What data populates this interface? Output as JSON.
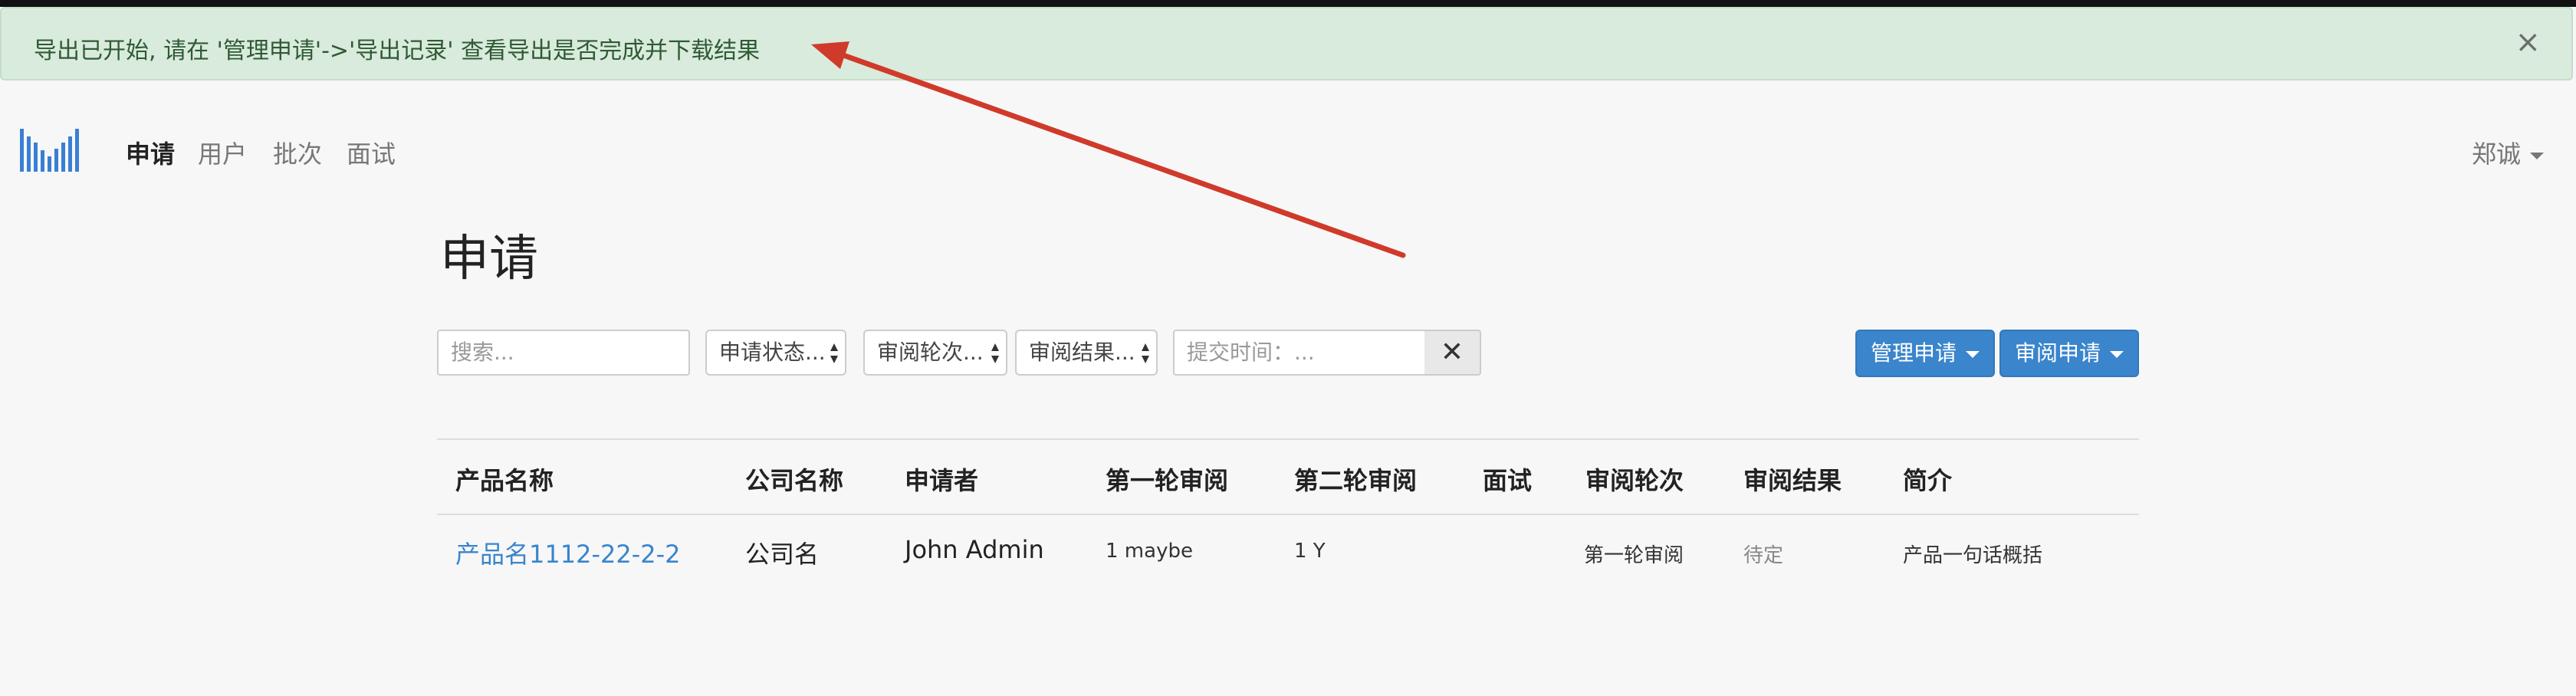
{
  "alert": {
    "message": "导出已开始, 请在 '管理申请'->'导出记录' 查看导出是否完成并下载结果",
    "close": "×"
  },
  "nav": {
    "items": [
      "申请",
      "用户",
      "批次",
      "面试"
    ],
    "user": "郑诚"
  },
  "page": {
    "title": "申请"
  },
  "filters": {
    "search_placeholder": "搜索...",
    "status": "申请状态...",
    "round": "审阅轮次...",
    "result": "审阅结果...",
    "submit_time_placeholder": "提交时间：...",
    "clear": "✕"
  },
  "actions": {
    "manage": "管理申请",
    "review": "审阅申请"
  },
  "table": {
    "headers": [
      "产品名称",
      "公司名称",
      "申请者",
      "第一轮审阅",
      "第二轮审阅",
      "面试",
      "审阅轮次",
      "审阅结果",
      "简介"
    ],
    "rows": [
      {
        "product": "产品名1112-22-2-2",
        "company": "公司名",
        "applicant": "John Admin",
        "round1": "1 maybe",
        "round2": "1 Y",
        "interview": "",
        "round": "第一轮审阅",
        "result": "待定",
        "intro": "产品一句话概括"
      }
    ]
  },
  "colors": {
    "alert_bg": "#d9ebdc",
    "primary": "#3a85cc",
    "arrow": "#d03a2a",
    "logo": "#3a7fd4"
  }
}
